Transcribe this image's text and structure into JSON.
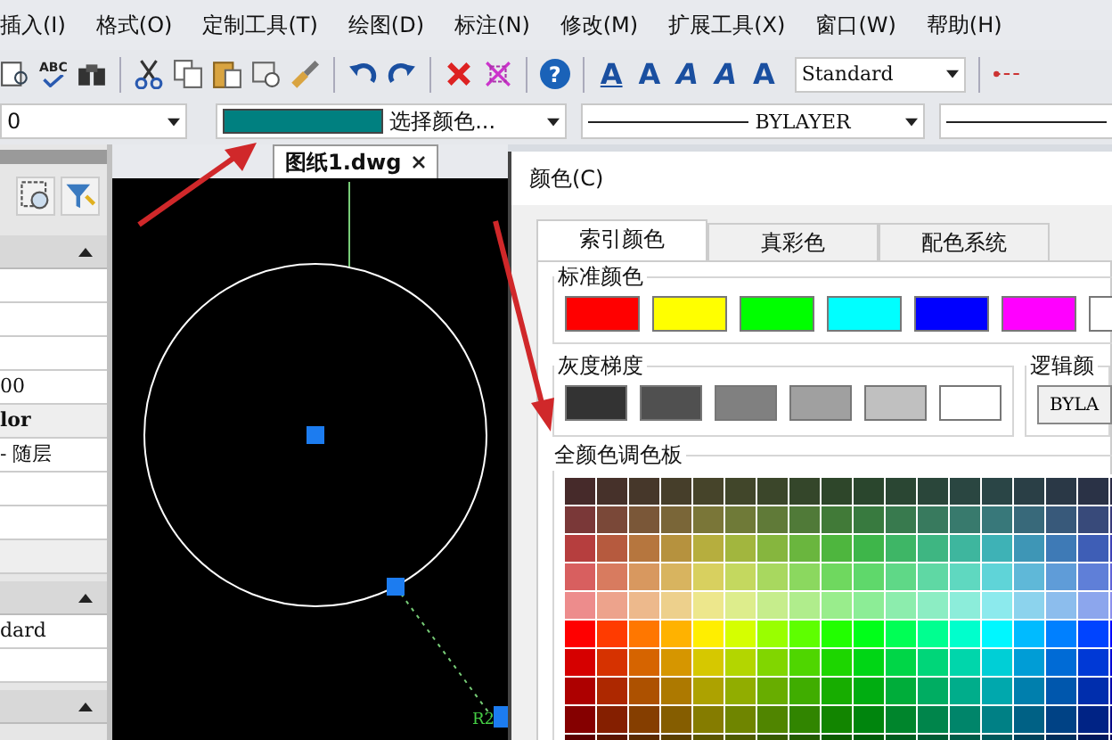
{
  "menu": [
    "插入(I)",
    "格式(O)",
    "定制工具(T)",
    "绘图(D)",
    "标注(N)",
    "修改(M)",
    "扩展工具(X)",
    "窗口(W)",
    "帮助(H)"
  ],
  "toolbar": {
    "spell_check_label": "ABC",
    "help_label": "?",
    "text_buttons": [
      "A",
      "A",
      "A",
      "A",
      "A"
    ],
    "text_style": "Standard"
  },
  "properties_bar": {
    "layer": "0",
    "color_label": "选择颜色...",
    "color": "#008080",
    "linetype": "BYLAYER"
  },
  "left_panel": {
    "rows": [
      {
        "kind": "header"
      },
      {
        "kind": "cell",
        "text": ""
      },
      {
        "kind": "cell",
        "text": ""
      },
      {
        "kind": "cell",
        "text": ""
      },
      {
        "kind": "cell",
        "text": "00"
      },
      {
        "kind": "label",
        "text": "lor"
      },
      {
        "kind": "cell",
        "text": "- 随层"
      },
      {
        "kind": "cell",
        "text": ""
      },
      {
        "kind": "cell",
        "text": ""
      },
      {
        "kind": "label",
        "text": ""
      },
      {
        "kind": "header"
      },
      {
        "kind": "cell",
        "text": "dard"
      },
      {
        "kind": "cell",
        "text": ""
      },
      {
        "kind": "header"
      }
    ]
  },
  "document_tab": {
    "label": "图纸1.dwg"
  },
  "drawing": {
    "dimension_label": "R2"
  },
  "dialog": {
    "title": "颜色(C)",
    "tabs": [
      {
        "label": "索引颜色",
        "selected": true
      },
      {
        "label": "真彩色",
        "selected": false
      },
      {
        "label": "配色系统",
        "selected": false
      }
    ],
    "standard_colors": {
      "label": "标准颜色",
      "swatches": [
        {
          "color": "#ff0000"
        },
        {
          "color": "#ffff00"
        },
        {
          "color": "#00ff00"
        },
        {
          "color": "#00ffff"
        },
        {
          "color": "#0000ff"
        },
        {
          "color": "#ff00ff"
        },
        {
          "color": "#ffffff"
        }
      ]
    },
    "grayscale": {
      "label": "灰度梯度",
      "swatches": [
        {
          "color": "#333333"
        },
        {
          "color": "#505050"
        },
        {
          "color": "#808080"
        },
        {
          "color": "#a0a0a0"
        },
        {
          "color": "#c0c0c0"
        },
        {
          "color": "#ffffff"
        }
      ]
    },
    "logical_colors": {
      "label": "逻辑颜",
      "button": "BYLA"
    },
    "full_palette": {
      "label": "全颜色调色板"
    }
  }
}
